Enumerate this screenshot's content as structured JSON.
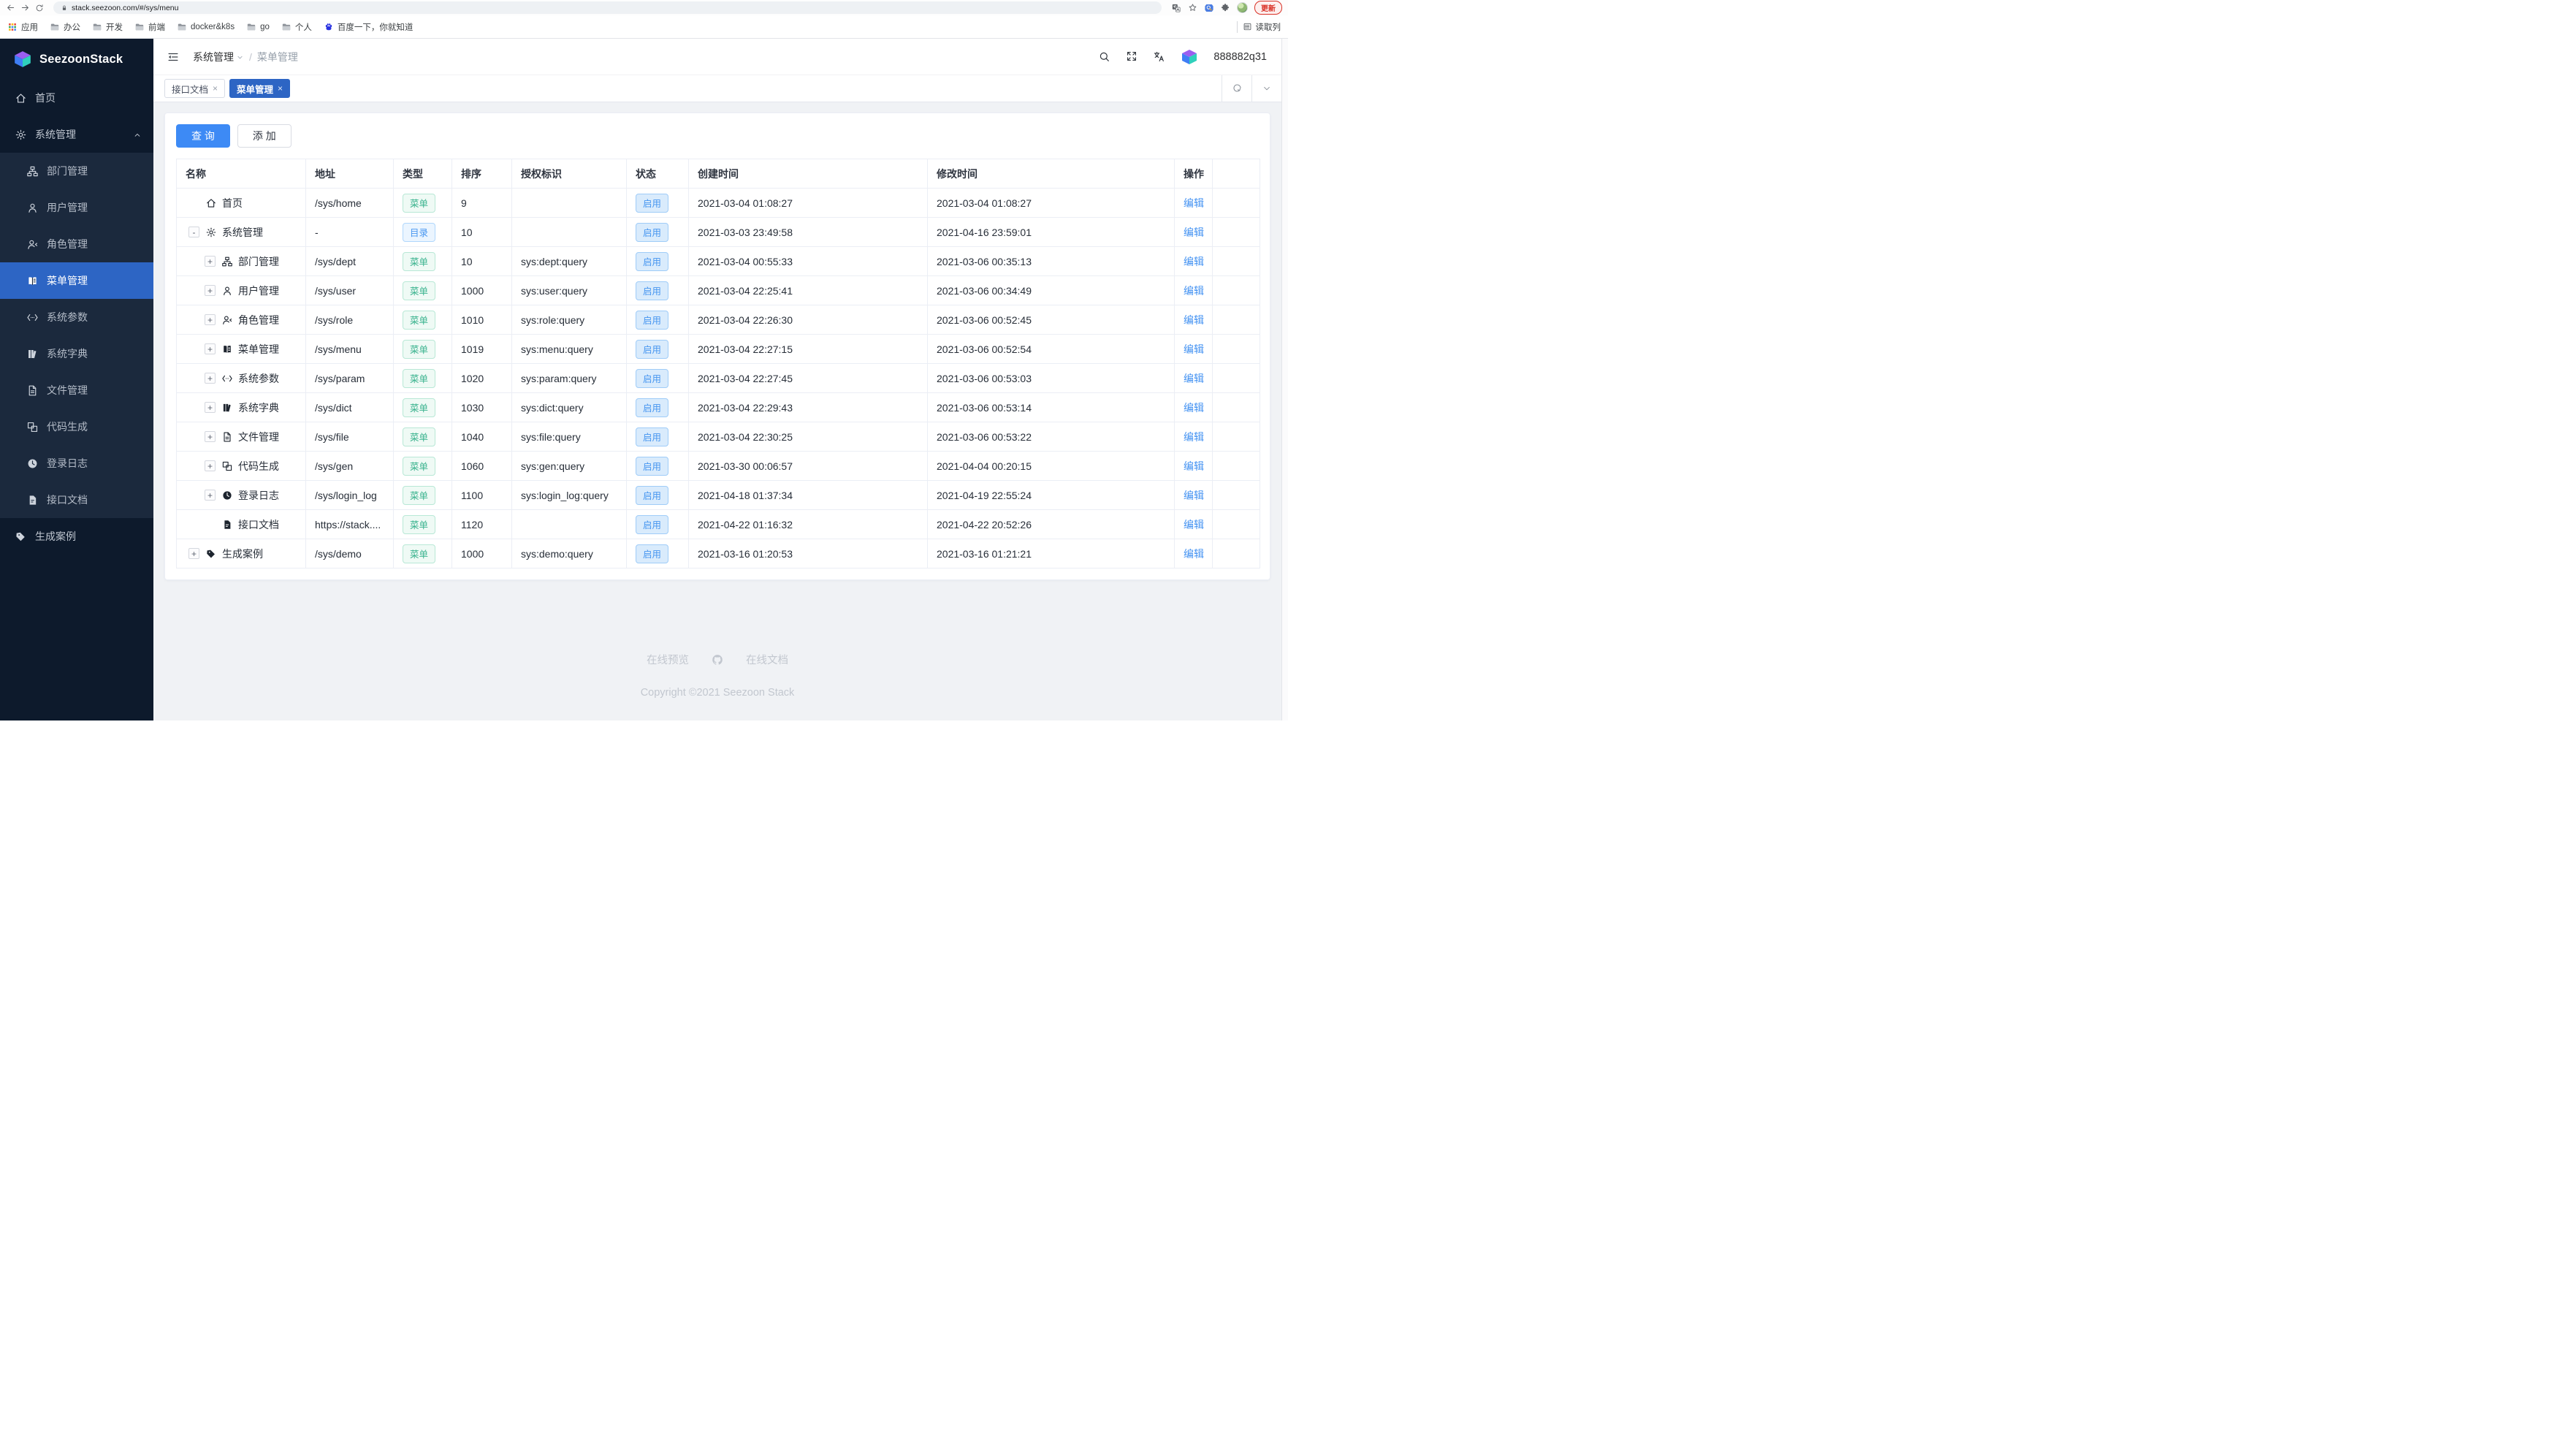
{
  "browser": {
    "url": "stack.seezoon.com/#/sys/menu",
    "update_label": "更新",
    "reading_list_label": "读取列",
    "bookmarks": [
      {
        "icon": "grid",
        "label": "应用"
      },
      {
        "icon": "folder",
        "label": "办公"
      },
      {
        "icon": "folder",
        "label": "开发"
      },
      {
        "icon": "folder",
        "label": "前端"
      },
      {
        "icon": "folder",
        "label": "docker&k8s"
      },
      {
        "icon": "folder",
        "label": "go"
      },
      {
        "icon": "folder",
        "label": "个人"
      },
      {
        "icon": "paw",
        "label": "百度一下，你就知道"
      }
    ]
  },
  "sidebar": {
    "brand": "SeezoonStack",
    "menu": [
      {
        "icon": "home",
        "label": "首页",
        "type": "root"
      },
      {
        "icon": "gear",
        "label": "系统管理",
        "type": "root",
        "expanded": true
      },
      {
        "icon": "org",
        "label": "部门管理",
        "type": "sub"
      },
      {
        "icon": "user",
        "label": "用户管理",
        "type": "sub"
      },
      {
        "icon": "user-arrow",
        "label": "角色管理",
        "type": "sub"
      },
      {
        "icon": "book",
        "label": "菜单管理",
        "type": "sub",
        "active": true
      },
      {
        "icon": "code",
        "label": "系统参数",
        "type": "sub"
      },
      {
        "icon": "books",
        "label": "系统字典",
        "type": "sub"
      },
      {
        "icon": "file",
        "label": "文件管理",
        "type": "sub"
      },
      {
        "icon": "squares",
        "label": "代码生成",
        "type": "sub"
      },
      {
        "icon": "clock",
        "label": "登录日志",
        "type": "sub"
      },
      {
        "icon": "doc",
        "label": "接口文档",
        "type": "sub"
      },
      {
        "icon": "tag",
        "label": "生成案例",
        "type": "root"
      }
    ]
  },
  "header": {
    "breadcrumb": [
      "系统管理",
      "菜单管理"
    ],
    "username": "888882q31"
  },
  "tabs": [
    {
      "label": "接口文档",
      "active": false
    },
    {
      "label": "菜单管理",
      "active": true
    }
  ],
  "toolbar": {
    "query_label": "查 询",
    "add_label": "添 加"
  },
  "table": {
    "columns": [
      "名称",
      "地址",
      "类型",
      "排序",
      "授权标识",
      "状态",
      "创建时间",
      "修改时间",
      "操作"
    ],
    "edit_label": "编辑",
    "status_enabled": "启用",
    "type_menu": "菜单",
    "type_dir": "目录",
    "rows": [
      {
        "indent": 0,
        "expander": "",
        "icon": "home",
        "name": "首页",
        "addr": "/sys/home",
        "type": "menu",
        "sort": "9",
        "perm": "",
        "created": "2021-03-04 01:08:27",
        "modified": "2021-03-04 01:08:27"
      },
      {
        "indent": 0,
        "expander": "-",
        "icon": "gear",
        "name": "系统管理",
        "addr": "-",
        "type": "dir",
        "sort": "10",
        "perm": "",
        "created": "2021-03-03 23:49:58",
        "modified": "2021-04-16 23:59:01"
      },
      {
        "indent": 1,
        "expander": "+",
        "icon": "org",
        "name": "部门管理",
        "addr": "/sys/dept",
        "type": "menu",
        "sort": "10",
        "perm": "sys:dept:query",
        "created": "2021-03-04 00:55:33",
        "modified": "2021-03-06 00:35:13"
      },
      {
        "indent": 1,
        "expander": "+",
        "icon": "user",
        "name": "用户管理",
        "addr": "/sys/user",
        "type": "menu",
        "sort": "1000",
        "perm": "sys:user:query",
        "created": "2021-03-04 22:25:41",
        "modified": "2021-03-06 00:34:49"
      },
      {
        "indent": 1,
        "expander": "+",
        "icon": "user-arrow",
        "name": "角色管理",
        "addr": "/sys/role",
        "type": "menu",
        "sort": "1010",
        "perm": "sys:role:query",
        "created": "2021-03-04 22:26:30",
        "modified": "2021-03-06 00:52:45"
      },
      {
        "indent": 1,
        "expander": "+",
        "icon": "book",
        "name": "菜单管理",
        "addr": "/sys/menu",
        "type": "menu",
        "sort": "1019",
        "perm": "sys:menu:query",
        "created": "2021-03-04 22:27:15",
        "modified": "2021-03-06 00:52:54"
      },
      {
        "indent": 1,
        "expander": "+",
        "icon": "code",
        "name": "系统参数",
        "addr": "/sys/param",
        "type": "menu",
        "sort": "1020",
        "perm": "sys:param:query",
        "created": "2021-03-04 22:27:45",
        "modified": "2021-03-06 00:53:03"
      },
      {
        "indent": 1,
        "expander": "+",
        "icon": "books",
        "name": "系统字典",
        "addr": "/sys/dict",
        "type": "menu",
        "sort": "1030",
        "perm": "sys:dict:query",
        "created": "2021-03-04 22:29:43",
        "modified": "2021-03-06 00:53:14"
      },
      {
        "indent": 1,
        "expander": "+",
        "icon": "file",
        "name": "文件管理",
        "addr": "/sys/file",
        "type": "menu",
        "sort": "1040",
        "perm": "sys:file:query",
        "created": "2021-03-04 22:30:25",
        "modified": "2021-03-06 00:53:22"
      },
      {
        "indent": 1,
        "expander": "+",
        "icon": "squares",
        "name": "代码生成",
        "addr": "/sys/gen",
        "type": "menu",
        "sort": "1060",
        "perm": "sys:gen:query",
        "created": "2021-03-30 00:06:57",
        "modified": "2021-04-04 00:20:15"
      },
      {
        "indent": 1,
        "expander": "+",
        "icon": "clock",
        "name": "登录日志",
        "addr": "/sys/login_log",
        "type": "menu",
        "sort": "1100",
        "perm": "sys:login_log:query",
        "created": "2021-04-18 01:37:34",
        "modified": "2021-04-19 22:55:24"
      },
      {
        "indent": 2,
        "expander": "",
        "icon": "doc",
        "name": "接口文档",
        "addr": "https://stack....",
        "type": "menu",
        "sort": "1120",
        "perm": "",
        "created": "2021-04-22 01:16:32",
        "modified": "2021-04-22 20:52:26"
      },
      {
        "indent": 0,
        "expander": "+",
        "icon": "tag",
        "name": "生成案例",
        "addr": "/sys/demo",
        "type": "menu",
        "sort": "1000",
        "perm": "sys:demo:query",
        "created": "2021-03-16 01:20:53",
        "modified": "2021-03-16 01:21:21"
      }
    ]
  },
  "footer": {
    "links": [
      "在线预览",
      "在线文档"
    ],
    "copyright": "Copyright ©2021 Seezoon Stack"
  }
}
